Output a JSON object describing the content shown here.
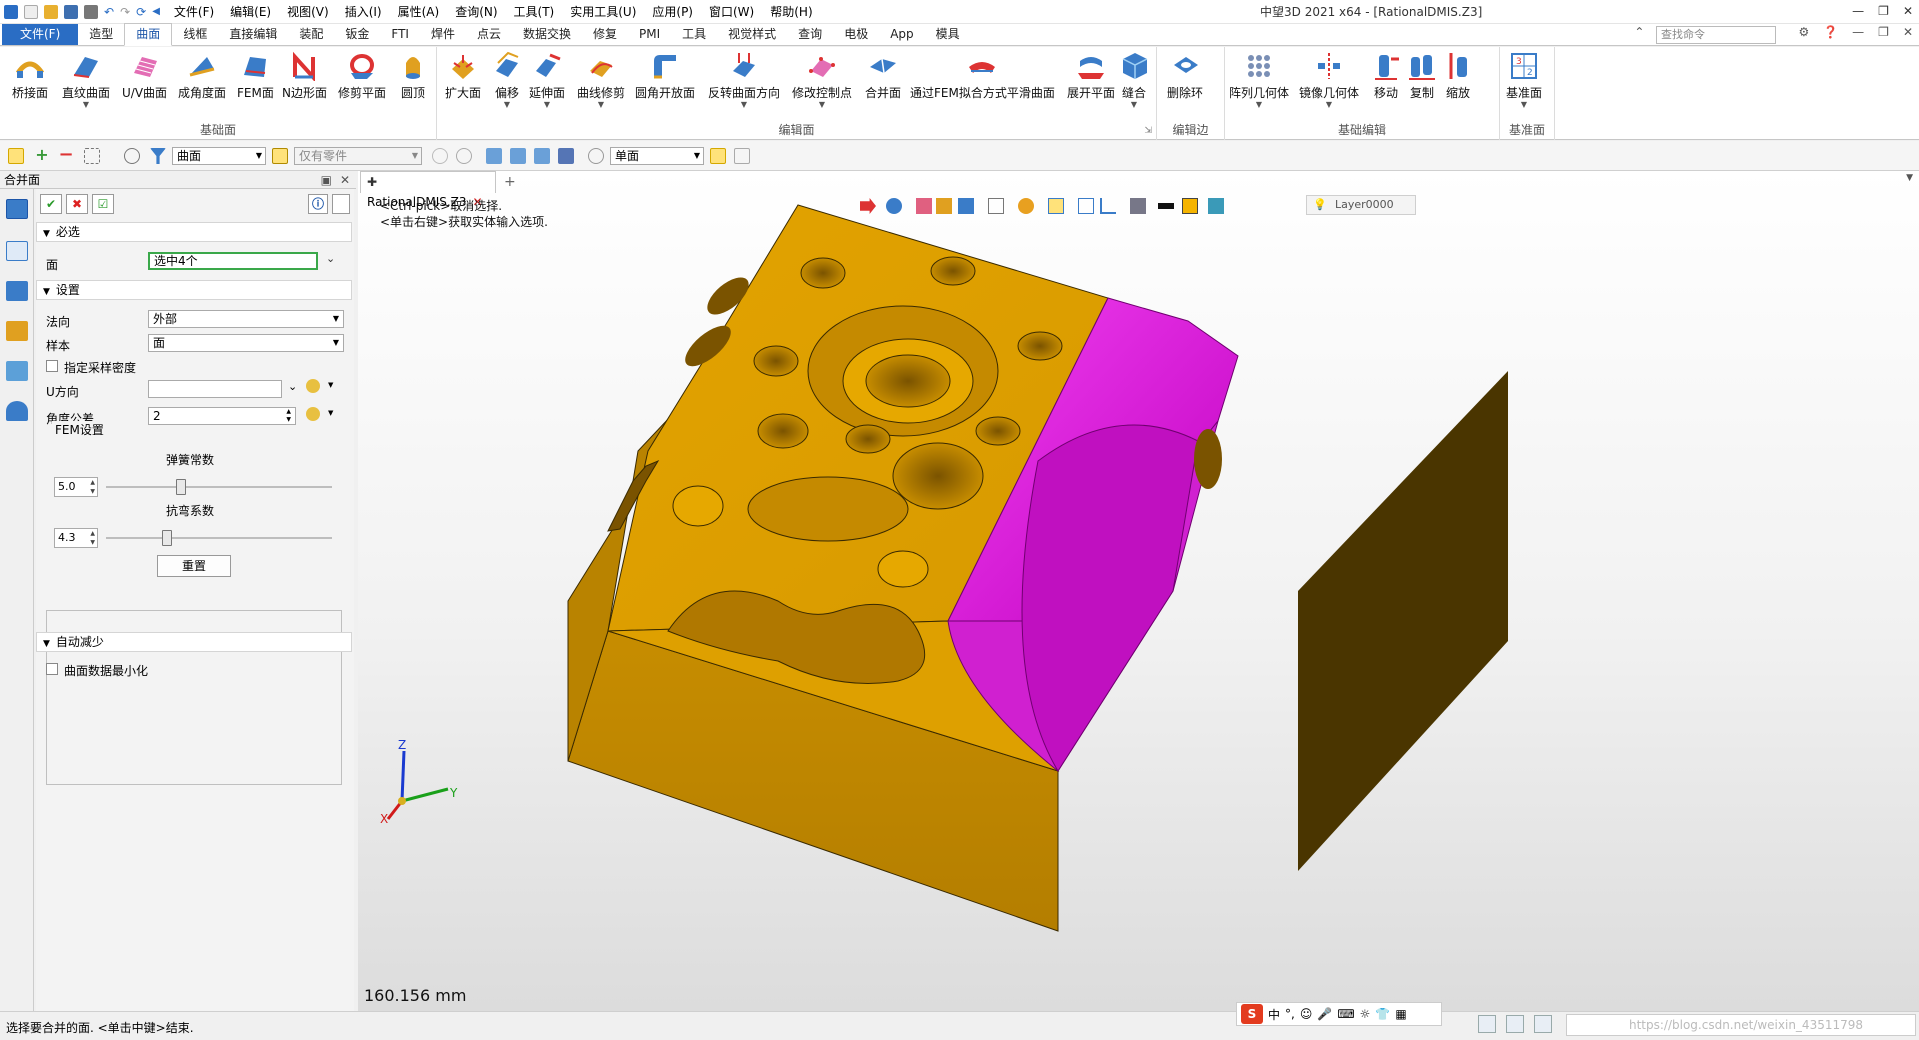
{
  "window": {
    "title": "中望3D 2021 x64 - [RationalDMIS.Z3]",
    "menus": [
      "文件(F)",
      "编辑(E)",
      "视图(V)",
      "插入(I)",
      "属性(A)",
      "查询(N)",
      "工具(T)",
      "实用工具(U)",
      "应用(P)",
      "窗口(W)",
      "帮助(H)"
    ]
  },
  "ribbon_tabs": {
    "file": "文件(F)",
    "tabs": [
      "造型",
      "曲面",
      "线框",
      "直接编辑",
      "装配",
      "钣金",
      "FTI",
      "焊件",
      "点云",
      "数据交换",
      "修复",
      "PMI",
      "工具",
      "视觉样式",
      "查询",
      "电极",
      "App",
      "模具"
    ],
    "active": "曲面",
    "search_placeholder": "查找命令"
  },
  "ribbon": {
    "groups": [
      {
        "label": "基础面",
        "buttons": [
          "桥接面",
          "直纹曲面",
          "U/V曲面",
          "成角度面",
          "FEM面",
          "N边形面",
          "修剪平面",
          "圆顶"
        ]
      },
      {
        "label": "编辑面",
        "buttons": [
          "扩大面",
          "偏移",
          "延伸面",
          "曲线修剪",
          "圆角开放面",
          "反转曲面方向",
          "修改控制点",
          "合并面",
          "通过FEM拟合方式平滑曲面",
          "展开平面",
          "缝合"
        ]
      },
      {
        "label": "编辑边",
        "buttons": [
          "删除环"
        ]
      },
      {
        "label": "基础编辑",
        "buttons": [
          "阵列几何体",
          "镜像几何体",
          "移动",
          "复制",
          "缩放"
        ]
      },
      {
        "label": "基准面",
        "buttons": [
          "基准面"
        ]
      }
    ]
  },
  "toolbar2": {
    "filter_value": "曲面",
    "part_filter": "仅有零件",
    "select_mode": "单面"
  },
  "panel": {
    "title": "合并面",
    "required_header": "必选",
    "face_label": "面",
    "face_value": "选中4个",
    "settings_header": "设置",
    "normal_label": "法向",
    "normal_value": "外部",
    "sample_label": "样本",
    "sample_value": "面",
    "density_label": "指定采样密度",
    "u_label": "U方向",
    "u_value": "",
    "angle_label": "角度公差",
    "angle_value": "2",
    "fem_label": "FEM设置",
    "spring_label": "弹簧常数",
    "spring_value": "5.0",
    "spring_fraction": 0.33,
    "bend_label": "抗弯系数",
    "bend_value": "4.3",
    "bend_fraction": 0.27,
    "reset_label": "重置",
    "auto_header": "自动减少",
    "minimize_label": "曲面数据最小化"
  },
  "viewport": {
    "tab": "RationalDMIS.Z3",
    "hint1": "<Ctrl-pick>取消选择.",
    "hint2": "<单击右键>获取实体输入选项.",
    "layer": "Layer0000",
    "scale": "160.156 mm",
    "axis_x": "X",
    "axis_y": "Y",
    "axis_z": "Z",
    "colors": {
      "part": "#dda000",
      "selected": "#e000e0"
    }
  },
  "status": {
    "prompt": "选择要合并的面. <单击中键>结束.",
    "ime_lang": "中",
    "watermark": "https://blog.csdn.net/weixin_43511798"
  }
}
